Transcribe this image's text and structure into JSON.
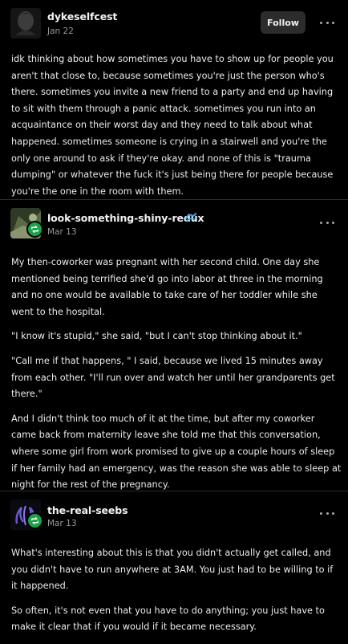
{
  "posts": [
    {
      "username": "dykeselfcest",
      "date": "Jan 22",
      "follow_label": "Follow",
      "more_icon": "ellipsis-icon",
      "paragraphs": [
        "idk thinking about how sometimes you have to show up for people you aren't that close to, because sometimes you're just the person who's there. sometimes you invite a new friend to a party and end up having to sit with them through a panic attack. sometimes you run into an acquaintance on their worst day and they need to talk about what happened. sometimes someone is crying in a stairwell and you're the only one around to ask if they're okay. and none of this is \"trauma dumping\" or whatever the fuck it's just being there for people because you're the one in the room with them."
      ]
    },
    {
      "username": "look-something-shiny-redux",
      "date": "Mar 13",
      "badge_icon": "reblog-icon",
      "flair_icon": "water-wave-icon",
      "more_icon": "ellipsis-icon",
      "paragraphs": [
        "My then-coworker was pregnant with her second child. One day she mentioned being terrified she'd go into labor at three in the morning and no one would be available to take care of her toddler while she went to the hospital.",
        "\"I know it's stupid,\" she said, \"but I can't stop thinking about it.\"",
        "\"Call me if that happens, \" I said, because we lived 15 minutes away from each other. \"I'll run over and watch her until her grandparents get there.\"",
        "And I didn't think too much of it at the time, but after my coworker came back from maternity leave she told me that this conversation, where some girl from work promised to give up a couple hours of sleep if her family had an emergency, was the reason she was able to sleep at night for the rest of the pregnancy."
      ]
    },
    {
      "username": "the-real-seebs",
      "date": "Mar 13",
      "badge_icon": "reblog-icon",
      "more_icon": "ellipsis-icon",
      "paragraphs": [
        "What's interesting about this is that you didn't actually get called, and you didn't have to run anywhere at 3AM. You just had to be willing to if it happened.",
        "So often, it's not even that you have to do anything; you just have to make it clear that if you would if it became necessary."
      ]
    }
  ],
  "colors": {
    "background": "#000000",
    "text": "#ececec",
    "muted": "#9a9a9a",
    "reblog_green": "#1aa34a",
    "flair_blue": "#3fa9e6"
  }
}
